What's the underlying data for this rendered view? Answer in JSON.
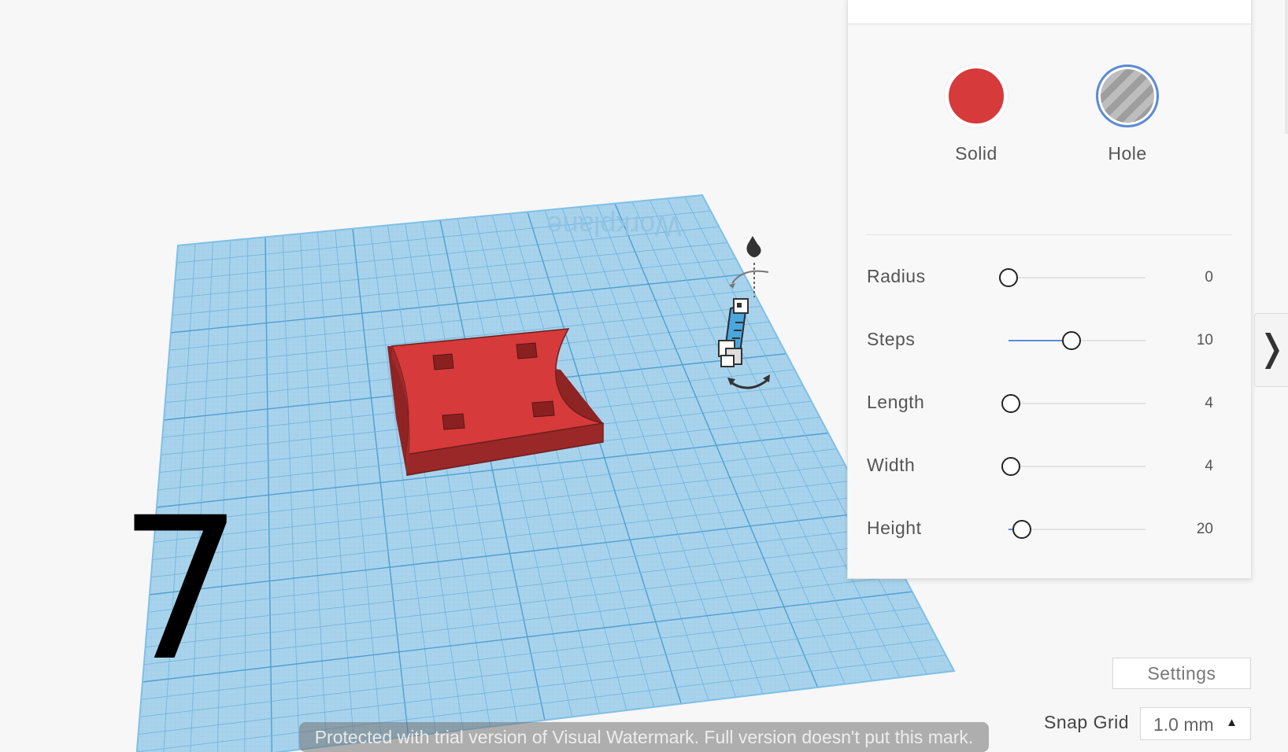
{
  "workplane": {
    "label": "Workplane"
  },
  "shape_panel": {
    "type_options": [
      {
        "label": "Solid",
        "selected": false,
        "color": "#d63a3a"
      },
      {
        "label": "Hole",
        "selected": true,
        "color": "#9e9e9e"
      }
    ],
    "params": [
      {
        "label": "Radius",
        "value": "0",
        "level": 0
      },
      {
        "label": "Steps",
        "value": "10",
        "level": 0.46
      },
      {
        "label": "Length",
        "value": "4",
        "level": 0.02
      },
      {
        "label": "Width",
        "value": "4",
        "level": 0.02
      },
      {
        "label": "Height",
        "value": "20",
        "level": 0.1
      }
    ]
  },
  "collapse_tab": {
    "glyph": "❭"
  },
  "settings": {
    "label": "Settings"
  },
  "snap_grid": {
    "label": "Snap Grid",
    "value": "1.0 mm",
    "arrow": "▲"
  },
  "step_number": "7",
  "watermark": "Protected with trial version of Visual Watermark. Full version doesn't put this mark.",
  "colors": {
    "accent": "#5a8bd6",
    "solid": "#d63a3a",
    "workplane": "#a9d3ec",
    "grid": "#5ea9d6"
  }
}
